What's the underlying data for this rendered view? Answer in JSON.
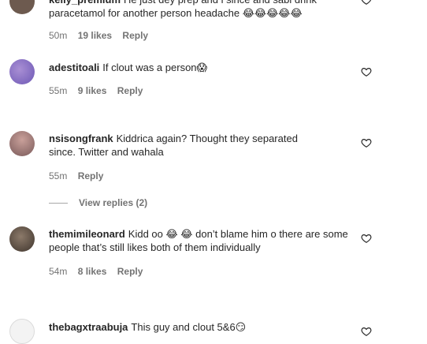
{
  "comments": [
    {
      "username": "kelly_premium",
      "text": "He just dey prep and i since and sabi drink paracetamol for another person headache 😂😂😂😂😂",
      "time": "50m",
      "likes": "19 likes",
      "reply": "Reply"
    },
    {
      "username": "adestitoali",
      "text": "If clout was a person😱",
      "time": "55m",
      "likes": "9 likes",
      "reply": "Reply"
    },
    {
      "username": "nsisongfrank",
      "text": "Kiddrica again? Thought they separated since. Twitter and wahala",
      "time": "55m",
      "reply": "Reply",
      "view_replies": "View replies (2)"
    },
    {
      "username": "themimileonard",
      "text": "Kidd oo 😂 😂 don’t blame him o there are some people that’s still likes both of them individually",
      "time": "54m",
      "likes": "8 likes",
      "reply": "Reply"
    },
    {
      "username": "thebagxtraabuja",
      "text": "This guy and clout 5&6😏",
      "time": "",
      "reply": ""
    }
  ],
  "icons": {
    "heart": "heart-outline-icon"
  },
  "colors": {
    "text": "#262626",
    "meta": "#737373"
  }
}
